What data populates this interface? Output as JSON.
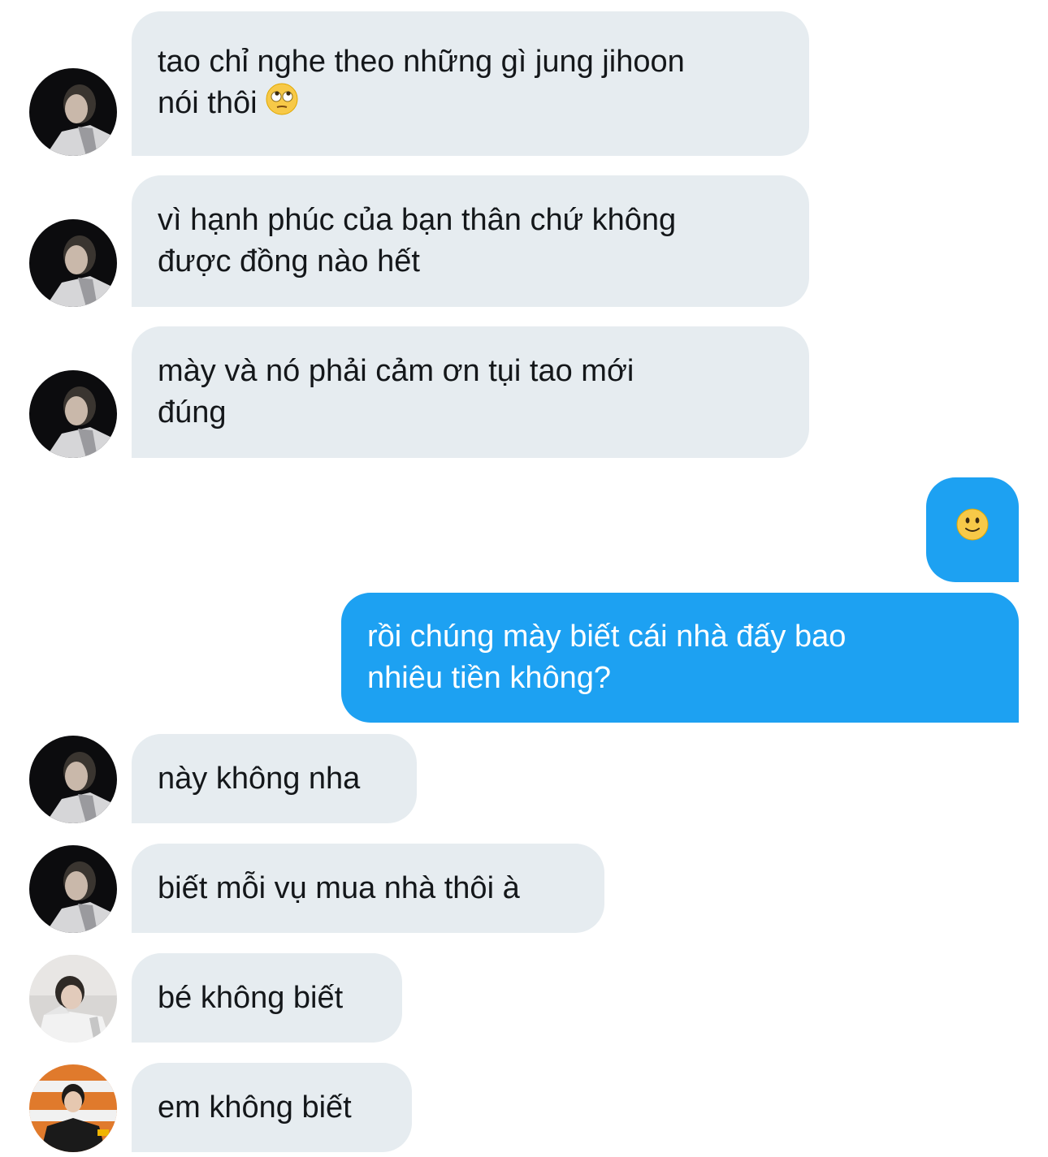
{
  "conversation": {
    "messages": [
      {
        "id": "m1",
        "sender": "incoming",
        "avatar": "avatar-dark-boy",
        "text": "tao chỉ nghe theo những gì jung jihoon\nnói thôi",
        "emoji": "face-with-rolling-eyes"
      },
      {
        "id": "m2",
        "sender": "incoming",
        "avatar": "avatar-dark-boy",
        "text": "vì hạnh phúc của bạn thân chứ không\nđược đồng nào hết"
      },
      {
        "id": "m3",
        "sender": "incoming",
        "avatar": "avatar-dark-boy",
        "text": "mày và nó phải cảm ơn tụi tao mới\nđúng"
      },
      {
        "id": "m4",
        "sender": "outgoing",
        "text": "",
        "emoji": "slightly-smiling-face"
      },
      {
        "id": "m5",
        "sender": "outgoing",
        "text": "rồi chúng mày biết cái nhà đấy bao\nnhiêu tiền không?"
      },
      {
        "id": "m6",
        "sender": "incoming",
        "avatar": "avatar-dark-boy",
        "text": "này không nha"
      },
      {
        "id": "m7",
        "sender": "incoming",
        "avatar": "avatar-dark-boy",
        "text": "biết mỗi vụ mua nhà thôi à"
      },
      {
        "id": "m8",
        "sender": "incoming",
        "avatar": "avatar-light-boy",
        "text": "bé không biết"
      },
      {
        "id": "m9",
        "sender": "incoming",
        "avatar": "avatar-orange-player",
        "text": "em không biết"
      }
    ]
  },
  "colors": {
    "incoming_bubble": "#e6ecf0",
    "outgoing_bubble": "#1da1f2",
    "incoming_text": "#14171a",
    "outgoing_text": "#ffffff"
  }
}
